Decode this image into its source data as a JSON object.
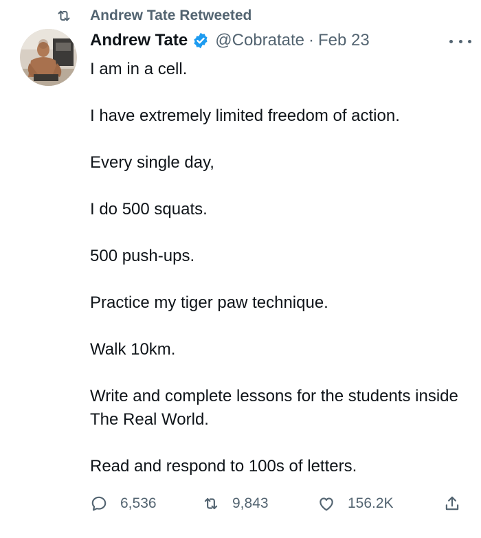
{
  "retweet_banner": {
    "icon": "retweet-icon",
    "label": "Andrew Tate Retweeted"
  },
  "tweet": {
    "avatar": "avatar-photo",
    "author_name": "Andrew Tate",
    "verified_icon": "verified-badge-icon",
    "handle": "@Cobratate",
    "separator": "·",
    "date": "Feb 23",
    "more_icon": "more-options-icon",
    "text": [
      "I am in a cell.",
      "I have extremely limited freedom of action.",
      "Every single day,",
      "I do 500 squats.",
      "500 push-ups.",
      "Practice my tiger paw technique.",
      "Walk 10km.",
      "Write and complete lessons for the students inside The Real World.",
      "Read and respond to 100s of letters."
    ]
  },
  "actions": {
    "reply": {
      "icon": "reply-icon",
      "count": "6,536"
    },
    "retweet": {
      "icon": "retweet-icon",
      "count": "9,843"
    },
    "like": {
      "icon": "heart-icon",
      "count": "156.2K"
    },
    "share": {
      "icon": "share-icon"
    }
  },
  "colors": {
    "text": "#0f1419",
    "muted": "#536471",
    "verified": "#1d9bf0",
    "background": "#ffffff"
  }
}
